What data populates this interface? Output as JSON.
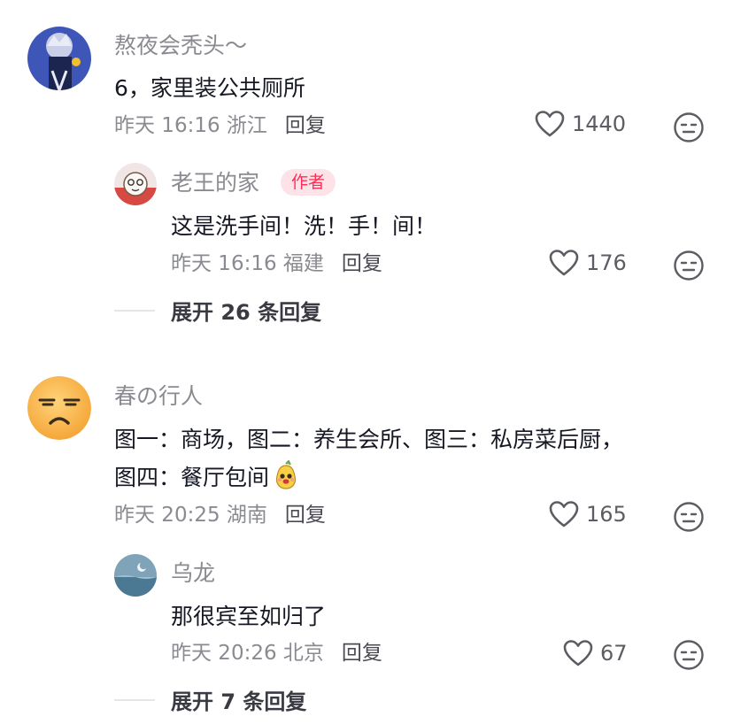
{
  "comments": [
    {
      "username": "熬夜会秃头～",
      "lines": [
        "6，家里装公共厕所"
      ],
      "meta": "昨天 16:16 浙江",
      "reply_label": "回复",
      "likes": "1440",
      "reply": {
        "username": "老王的家",
        "badge": "作者",
        "text": "这是洗手间！洗！手！间！",
        "meta": "昨天 16:16 福建",
        "reply_label": "回复",
        "likes": "176"
      },
      "expand_label": "展开 26 条回复"
    },
    {
      "username": "春の行人",
      "lines": [
        "图一：商场，图二：养生会所、图三：私房菜后厨，",
        "图四：餐厅包间"
      ],
      "meta": "昨天 20:25 湖南",
      "reply_label": "回复",
      "likes": "165",
      "reply": {
        "username": "乌龙",
        "text": "那很宾至如归了",
        "meta": "昨天 20:26 北京",
        "reply_label": "回复",
        "likes": "67"
      },
      "expand_label": "展开 7 条回复"
    }
  ],
  "colors": {
    "badge": "#fe2c55",
    "secondary_text": "#8a8b91",
    "primary_text": "#161823"
  }
}
